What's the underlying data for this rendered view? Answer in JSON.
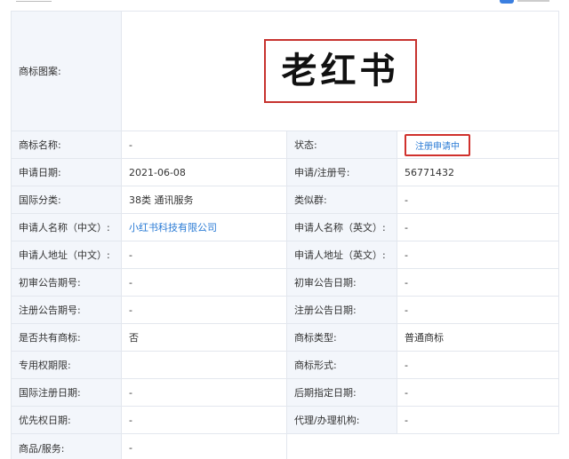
{
  "trademark": {
    "image_label": "商标图案:",
    "image_text": "老红书",
    "rows": [
      {
        "l1": "商标名称:",
        "v1": "-",
        "l2": "状态:",
        "v2": "注册申请中"
      },
      {
        "l1": "申请日期:",
        "v1": "2021-06-08",
        "l2": "申请/注册号:",
        "v2": "56771432"
      },
      {
        "l1": "国际分类:",
        "v1": "38类 通讯服务",
        "l2": "类似群:",
        "v2": "-"
      },
      {
        "l1": "申请人名称（中文）:",
        "v1": "小红书科技有限公司",
        "l2": "申请人名称（英文）:",
        "v2": "-"
      },
      {
        "l1": "申请人地址（中文）:",
        "v1": "-",
        "l2": "申请人地址（英文）:",
        "v2": "-"
      },
      {
        "l1": "初审公告期号:",
        "v1": "-",
        "l2": "初审公告日期:",
        "v2": "-"
      },
      {
        "l1": "注册公告期号:",
        "v1": "-",
        "l2": "注册公告日期:",
        "v2": "-"
      },
      {
        "l1": "是否共有商标:",
        "v1": "否",
        "l2": "商标类型:",
        "v2": "普通商标"
      },
      {
        "l1": "专用权期限:",
        "v1": "",
        "l2": "商标形式:",
        "v2": "-"
      },
      {
        "l1": "国际注册日期:",
        "v1": "-",
        "l2": "后期指定日期:",
        "v2": "-"
      },
      {
        "l1": "优先权日期:",
        "v1": "-",
        "l2": "代理/办理机构:",
        "v2": "-"
      }
    ],
    "goods_label": "商品/服务:",
    "goods_value": "-"
  },
  "colors": {
    "status_link": "#2a7bd5",
    "highlight_border": "#d0312d",
    "label_bg": "#f3f6fb"
  }
}
